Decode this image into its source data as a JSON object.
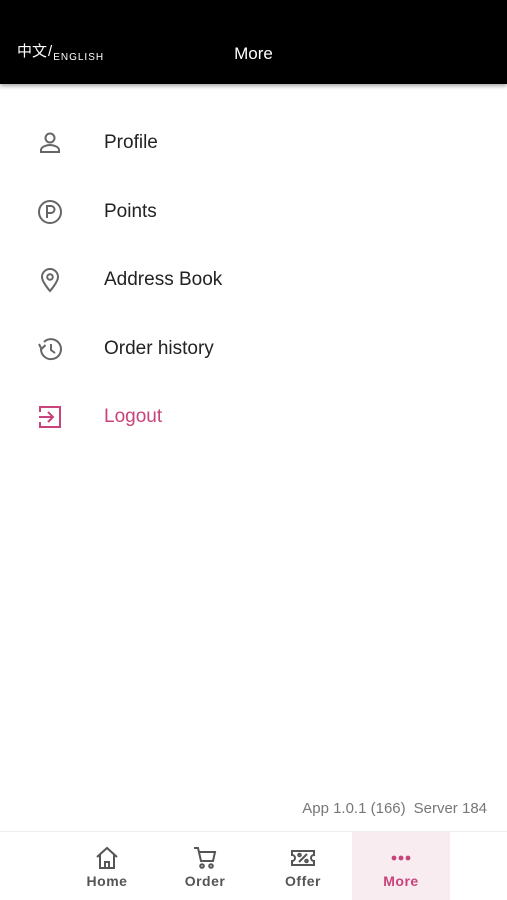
{
  "header": {
    "lang_zh": "中文",
    "lang_sep": "/",
    "lang_en": "ENGLISH",
    "title": "More"
  },
  "menu": {
    "items": [
      {
        "label": "Profile",
        "icon": "person-icon"
      },
      {
        "label": "Points",
        "icon": "points-icon"
      },
      {
        "label": "Address Book",
        "icon": "location-pin-icon"
      },
      {
        "label": "Order history",
        "icon": "history-icon"
      },
      {
        "label": "Logout",
        "icon": "logout-icon"
      }
    ]
  },
  "footer": {
    "app_version": "App 1.0.1 (166)",
    "server_version": "Server 184"
  },
  "bottom_nav": {
    "tabs": [
      {
        "label": "Home",
        "icon": "home-icon"
      },
      {
        "label": "Order",
        "icon": "cart-icon"
      },
      {
        "label": "Offer",
        "icon": "coupon-icon"
      },
      {
        "label": "More",
        "icon": "more-dots-icon",
        "active": true
      }
    ]
  },
  "colors": {
    "accent": "#c8437a",
    "header_bg": "#000000",
    "icon_gray": "#666666",
    "active_tab_bg": "#f8ecf1"
  }
}
